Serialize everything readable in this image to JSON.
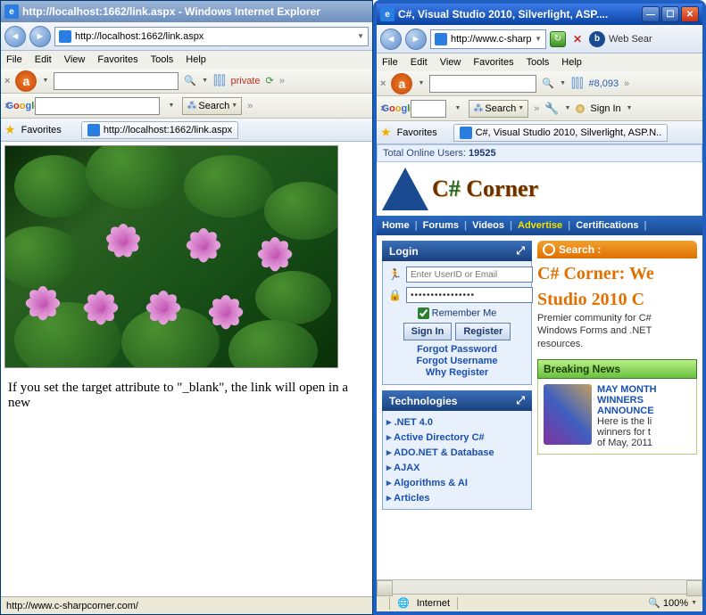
{
  "left": {
    "title": "http://localhost:1662/link.aspx - Windows Internet Explorer",
    "url": "http://localhost:1662/link.aspx",
    "menu": {
      "file": "File",
      "edit": "Edit",
      "view": "View",
      "favorites": "Favorites",
      "tools": "Tools",
      "help": "Help"
    },
    "ask_private": "private",
    "google": "Google",
    "search_btn": "Search",
    "favorites": "Favorites",
    "tab": "http://localhost:1662/link.aspx",
    "body_text": "If you set the target attribute to \"_blank\", the link will open in a new",
    "status": "http://www.c-sharpcorner.com/"
  },
  "right": {
    "title": "C#, Visual Studio 2010, Silverlight, ASP....",
    "url": "http://www.c-sharp...",
    "websearch": "Web Sear",
    "menu": {
      "file": "File",
      "edit": "Edit",
      "view": "View",
      "favorites": "Favorites",
      "tools": "Tools",
      "help": "Help"
    },
    "rank": "#8,093",
    "google": "Google",
    "search_btn": "Search",
    "signin_tb": "Sign In",
    "favorites": "Favorites",
    "tab": "C#, Visual Studio 2010, Silverlight, ASP.N...",
    "online_label": "Total Online Users: ",
    "online_count": "19525",
    "logo": "C# Corner",
    "nav": {
      "home": "Home",
      "forums": "Forums",
      "videos": "Videos",
      "advertise": "Advertise",
      "cert": "Certifications",
      "sep": "|"
    },
    "login": {
      "head": "Login",
      "user_ph": "Enter UserID or Email",
      "pass_val": "••••••••••••••••",
      "remember": "Remember Me",
      "signin": "Sign In",
      "register": "Register",
      "forgot_pw": "Forgot Password",
      "forgot_un": "Forgot Username",
      "why": "Why Register"
    },
    "tech": {
      "head": "Technologies",
      "items": [
        ".NET 4.0",
        "Active Directory C#",
        "ADO.NET & Database",
        "AJAX",
        "Algorithms & AI",
        "Articles"
      ]
    },
    "search_label": "Search :",
    "headline": "C# Corner: We",
    "headline2": "Studio 2010 C",
    "subhead": "Premier community for C#\nWindows Forms and .NET\nresources.",
    "news_head": "Breaking News",
    "news_title": "MAY MONTH\nWINNERS\nANNOUNCE",
    "news_body": "Here is the li\nwinners for t\nof May, 2011",
    "status_zone": "Internet",
    "zoom": "100%"
  }
}
